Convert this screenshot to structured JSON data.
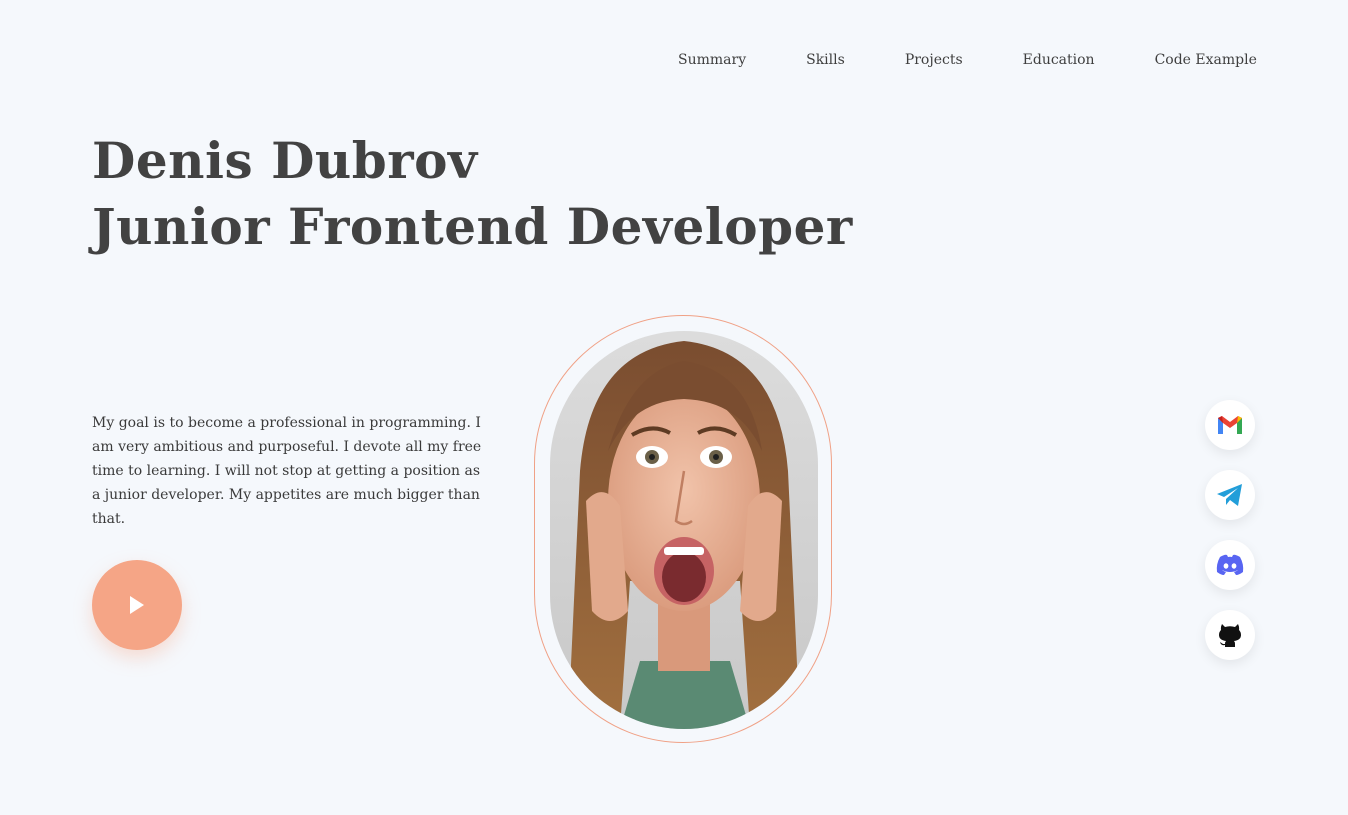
{
  "nav": {
    "items": [
      "Summary",
      "Skills",
      "Projects",
      "Education",
      "Code Example"
    ]
  },
  "hero": {
    "name": "Denis Dubrov",
    "role": "Junior Frontend Developer",
    "summary": "My goal is to become a professional in programming. I am very ambitious and purposeful. I devote all my free time to learning. I will not stop at getting a position as a junior developer. My appetites are much bigger than that."
  },
  "play_button": {
    "icon": "play-icon"
  },
  "portrait": {
    "subject": "portrait-photo"
  },
  "social": {
    "items": [
      {
        "icon": "gmail-icon"
      },
      {
        "icon": "telegram-icon"
      },
      {
        "icon": "discord-icon"
      },
      {
        "icon": "github-icon"
      }
    ]
  },
  "colors": {
    "background": "#f5f8fc",
    "accent": "#f5a586",
    "text": "#424242"
  }
}
